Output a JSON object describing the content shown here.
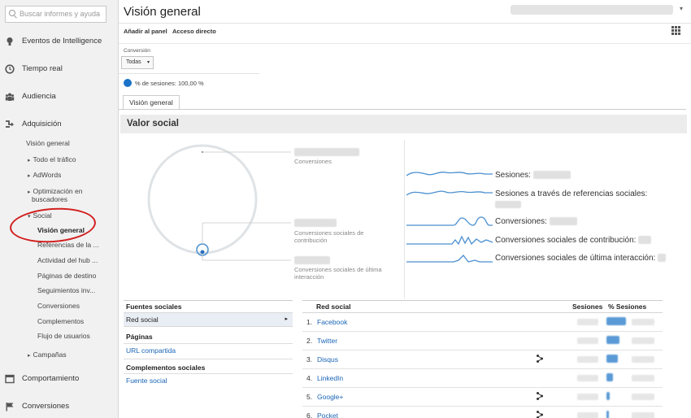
{
  "sidebar": {
    "search_placeholder": "Buscar informes y ayuda",
    "sections": [
      {
        "label": "Eventos de Intelligence",
        "icon": "lightbulb-icon"
      },
      {
        "label": "Tiempo real",
        "icon": "clock-icon"
      },
      {
        "label": "Audiencia",
        "icon": "people-icon"
      },
      {
        "label": "Adquisición",
        "icon": "acquisition-arrow-icon"
      },
      {
        "label": "Comportamiento",
        "icon": "window-icon"
      },
      {
        "label": "Conversiones",
        "icon": "flag-icon"
      }
    ],
    "acquisition_items": {
      "overview": "Visión general",
      "all_traffic": "Todo el tráfico",
      "adwords": "AdWords",
      "seo_line1": "Optimización en",
      "seo_line2": "buscadores",
      "social": "Social",
      "social_overview": "Visión general",
      "referrals": "Referencias de la ...",
      "hub_activity": "Actividad del hub ...",
      "landing_pages": "Páginas de destino",
      "plugins_tracking": "Seguimientos inv...",
      "conversions": "Conversiones",
      "plugins": "Complementos",
      "user_flow": "Flujo de usuarios",
      "campaigns": "Campañas"
    }
  },
  "header": {
    "title": "Visión general",
    "add_to_panel": "Añadir al panel",
    "shortcut": "Acceso directo"
  },
  "segment": {
    "label": "Conversión",
    "value": "Todas",
    "sessions_pct": "% de sesiones: 100,00 %"
  },
  "tab": "Visión general",
  "social_value": {
    "title": "Valor social",
    "circle_labels": {
      "conversions": "Conversiones",
      "assisted_line1": "Conversiones sociales de",
      "assisted_line2": "contribución",
      "last_line1": "Conversiones sociales de última",
      "last_line2": "interacción"
    },
    "spark_labels": {
      "sessions": "Sesiones:",
      "social_ref_sessions": "Sesiones a través de referencias sociales:",
      "conversions": "Conversiones:",
      "assisted": "Conversiones sociales de contribución:",
      "last": "Conversiones sociales de última interacción:"
    }
  },
  "left_table": {
    "sources_header": "Fuentes sociales",
    "red_social": "Red social",
    "pages_header": "Páginas",
    "shared_url": "URL compartida",
    "plugins_header": "Complementos sociales",
    "social_source": "Fuente social"
  },
  "right_table": {
    "col_network": "Red social",
    "col_sessions": "Sesiones",
    "col_pct": "% Sesiones",
    "rows": [
      {
        "num": "1.",
        "name": "Facebook"
      },
      {
        "num": "2.",
        "name": "Twitter"
      },
      {
        "num": "3.",
        "name": "Disqus"
      },
      {
        "num": "4.",
        "name": "LinkedIn"
      },
      {
        "num": "5.",
        "name": "Google+"
      },
      {
        "num": "6.",
        "name": "Pocket"
      }
    ]
  },
  "colors": {
    "accent": "#1a65b5",
    "highlight_circle": "#d21f1f",
    "spark_line": "#4a8fd0"
  }
}
